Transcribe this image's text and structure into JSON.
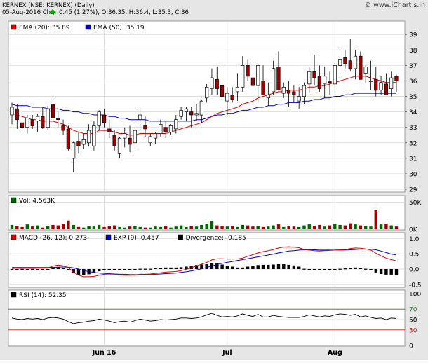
{
  "header": {
    "line1": "KERNEX (NSE: KERNEX) (Daily)",
    "line2_prefix": "05-Aug-2016 Chg:",
    "line2_change": "0.45 (1.27%), O:36.35, H:36.4, L:35.3, C:36",
    "brand": "© www.iChart s.in",
    "arrow_color": "#00aa00"
  },
  "colors": {
    "frame_bg": "#e6e6e6",
    "panel_bg": "#ffffff",
    "grid": "#d8d8d8",
    "up_fill": "#ffffff",
    "down_fill": "#a00000",
    "ema20": "#dd0000",
    "ema50": "#0000cc",
    "vol_up": "#006600",
    "vol_down": "#a00000",
    "macd": "#dd0000",
    "signal": "#0000cc",
    "divergence": "#000000",
    "rsi": "#000000",
    "rsi_70": "#2a7a2a",
    "rsi_30": "#c02020"
  },
  "chart_data": [
    {
      "type": "candlestick",
      "title": "Price",
      "legend": [
        {
          "label": "EMA (20): 35.89",
          "color": "#dd0000"
        },
        {
          "label": "EMA (50): 35.19",
          "color": "#0000cc"
        }
      ],
      "ylim": [
        29,
        39.5
      ],
      "y_ticks": [
        "29",
        "30",
        "31",
        "32",
        "33",
        "34",
        "35",
        "36",
        "37",
        "38",
        "39"
      ],
      "x_labels": [
        {
          "label": "Jun 16",
          "index": 18
        },
        {
          "label": "Jul",
          "index": 42
        },
        {
          "label": "Aug",
          "index": 63
        }
      ],
      "ohlc": [
        [
          33.8,
          34.6,
          33.2,
          34.3
        ],
        [
          34.2,
          34.5,
          32.9,
          33.5
        ],
        [
          33.3,
          33.7,
          32.6,
          33.0
        ],
        [
          33.0,
          33.8,
          32.6,
          33.6
        ],
        [
          33.5,
          33.8,
          32.9,
          33.1
        ],
        [
          33.4,
          33.9,
          32.7,
          33.7
        ],
        [
          33.7,
          34.3,
          32.9,
          33.0
        ],
        [
          33.0,
          34.4,
          32.8,
          34.2
        ],
        [
          34.5,
          34.8,
          33.2,
          33.6
        ],
        [
          33.6,
          34.0,
          33.0,
          33.5
        ],
        [
          33.1,
          33.5,
          32.5,
          32.8
        ],
        [
          32.9,
          33.1,
          31.5,
          31.6
        ],
        [
          31.0,
          32.1,
          30.1,
          32.0
        ],
        [
          32.1,
          32.7,
          31.3,
          31.8
        ],
        [
          31.9,
          32.6,
          31.6,
          32.2
        ],
        [
          32.0,
          33.2,
          31.8,
          32.8
        ],
        [
          31.8,
          33.4,
          31.5,
          33.1
        ],
        [
          33.1,
          34.1,
          32.8,
          34.0
        ],
        [
          33.8,
          34.2,
          33.0,
          33.3
        ],
        [
          32.9,
          33.5,
          32.3,
          32.7
        ],
        [
          32.5,
          32.8,
          31.5,
          31.8
        ],
        [
          31.3,
          32.4,
          31.0,
          32.3
        ],
        [
          32.3,
          33.0,
          31.7,
          32.6
        ],
        [
          32.3,
          33.1,
          31.4,
          31.9
        ],
        [
          32.0,
          33.0,
          31.5,
          32.8
        ],
        [
          33.5,
          34.3,
          32.8,
          33.8
        ],
        [
          33.1,
          33.7,
          32.4,
          32.9
        ],
        [
          32.0,
          32.6,
          31.8,
          32.4
        ],
        [
          32.3,
          32.7,
          31.9,
          32.6
        ],
        [
          32.6,
          33.5,
          32.4,
          33.2
        ],
        [
          33.0,
          33.4,
          32.3,
          32.7
        ],
        [
          32.7,
          33.2,
          32.5,
          33.1
        ],
        [
          32.9,
          33.8,
          32.6,
          33.5
        ],
        [
          33.7,
          34.3,
          33.5,
          34.1
        ],
        [
          34.0,
          34.3,
          33.4,
          34.2
        ],
        [
          34.0,
          34.3,
          33.0,
          33.8
        ],
        [
          33.8,
          34.5,
          33.4,
          33.9
        ],
        [
          33.8,
          34.8,
          33.3,
          34.7
        ],
        [
          34.9,
          35.8,
          34.6,
          35.6
        ],
        [
          35.5,
          36.8,
          35.1,
          36.2
        ],
        [
          36.1,
          36.9,
          35.1,
          35.5
        ],
        [
          35.7,
          37.0,
          35.3,
          35.0
        ],
        [
          34.7,
          35.6,
          33.8,
          35.2
        ],
        [
          35.1,
          35.6,
          34.6,
          34.8
        ],
        [
          35.3,
          36.5,
          34.7,
          35.6
        ],
        [
          35.6,
          37.6,
          35.3,
          37.0
        ],
        [
          37.0,
          37.4,
          36.0,
          36.3
        ],
        [
          36.2,
          36.9,
          35.0,
          35.7
        ],
        [
          35.7,
          37.1,
          34.6,
          37.0
        ],
        [
          36.0,
          37.0,
          35.2,
          35.1
        ],
        [
          34.9,
          35.9,
          34.4,
          35.1
        ],
        [
          35.3,
          37.3,
          35.1,
          36.8
        ],
        [
          36.9,
          37.9,
          35.8,
          35.4
        ],
        [
          35.2,
          35.9,
          34.9,
          35.6
        ],
        [
          35.4,
          36.0,
          34.3,
          35.2
        ],
        [
          35.3,
          35.7,
          34.6,
          35.1
        ],
        [
          34.7,
          35.6,
          34.2,
          35.0
        ],
        [
          35.0,
          35.9,
          34.5,
          35.7
        ],
        [
          35.8,
          36.9,
          35.2,
          36.6
        ],
        [
          36.6,
          37.7,
          35.7,
          36.2
        ],
        [
          36.3,
          37.0,
          35.3,
          35.5
        ],
        [
          35.8,
          36.9,
          34.9,
          36.3
        ],
        [
          36.0,
          36.6,
          35.1,
          35.9
        ],
        [
          35.8,
          37.2,
          35.4,
          37.0
        ],
        [
          37.0,
          38.2,
          36.3,
          37.4
        ],
        [
          37.5,
          38.0,
          36.8,
          37.1
        ],
        [
          37.3,
          38.7,
          36.6,
          36.8
        ],
        [
          36.8,
          38.0,
          36.1,
          37.6
        ],
        [
          37.6,
          37.9,
          36.5,
          36.1
        ],
        [
          36.5,
          37.0,
          35.9,
          36.9
        ],
        [
          36.0,
          37.3,
          35.4,
          36.0
        ],
        [
          36.1,
          36.9,
          35.0,
          35.4
        ],
        [
          35.4,
          36.3,
          35.1,
          35.9
        ],
        [
          35.8,
          36.5,
          35.1,
          35.1
        ],
        [
          35.5,
          36.6,
          35.0,
          36.2
        ],
        [
          36.3,
          36.4,
          35.3,
          36.0
        ]
      ],
      "ema20": [
        33.9,
        33.8,
        33.7,
        33.6,
        33.5,
        33.5,
        33.4,
        33.4,
        33.4,
        33.3,
        33.2,
        33.0,
        32.8,
        32.7,
        32.6,
        32.6,
        32.6,
        32.8,
        32.8,
        32.8,
        32.7,
        32.6,
        32.6,
        32.5,
        32.5,
        32.6,
        32.6,
        32.6,
        32.6,
        32.6,
        32.6,
        32.7,
        32.8,
        32.9,
        33.0,
        33.1,
        33.2,
        33.3,
        33.5,
        33.7,
        33.9,
        34.0,
        34.1,
        34.2,
        34.3,
        34.5,
        34.6,
        34.7,
        34.9,
        35.0,
        35.1,
        35.2,
        35.3,
        35.3,
        35.4,
        35.4,
        35.4,
        35.5,
        35.6,
        35.6,
        35.7,
        35.7,
        35.8,
        35.9,
        36.0,
        36.1,
        36.2,
        36.3,
        36.3,
        36.3,
        36.2,
        36.1,
        36.0,
        35.9,
        35.9,
        35.9
      ],
      "ema50": [
        34.5,
        34.4,
        34.4,
        34.4,
        34.3,
        34.3,
        34.3,
        34.2,
        34.2,
        34.2,
        34.1,
        34.1,
        34.0,
        34.0,
        33.9,
        33.9,
        33.8,
        33.8,
        33.8,
        33.7,
        33.7,
        33.6,
        33.6,
        33.5,
        33.5,
        33.5,
        33.5,
        33.4,
        33.4,
        33.4,
        33.4,
        33.4,
        33.4,
        33.4,
        33.4,
        33.4,
        33.5,
        33.5,
        33.6,
        33.7,
        33.8,
        33.8,
        33.9,
        33.9,
        34.0,
        34.1,
        34.1,
        34.2,
        34.3,
        34.3,
        34.4,
        34.4,
        34.5,
        34.5,
        34.6,
        34.6,
        34.6,
        34.7,
        34.7,
        34.8,
        34.8,
        34.9,
        34.9,
        35.0,
        35.0,
        35.1,
        35.1,
        35.2,
        35.2,
        35.2,
        35.2,
        35.2,
        35.2,
        35.2,
        35.2,
        35.2
      ]
    },
    {
      "type": "bar",
      "title": "Volume",
      "legend": [
        {
          "label": "Vol: 4.563K",
          "color": "#006600"
        }
      ],
      "y_ticks": [
        "50K",
        "0K"
      ],
      "ylim": [
        0,
        60000
      ],
      "volume": [
        8000,
        6000,
        4000,
        9000,
        5000,
        7000,
        3000,
        6000,
        8000,
        7000,
        10000,
        16000,
        8000,
        4000,
        3000,
        6000,
        5000,
        8000,
        4000,
        6000,
        7000,
        4000,
        3000,
        5000,
        6000,
        4000,
        3000,
        3000,
        5000,
        4000,
        6000,
        3000,
        5000,
        7000,
        4000,
        6000,
        5000,
        8000,
        10000,
        15000,
        7000,
        6000,
        5000,
        6000,
        4000,
        8000,
        7000,
        5000,
        6000,
        4000,
        5000,
        7000,
        9000,
        4000,
        6000,
        5000,
        4000,
        7000,
        9000,
        6000,
        8000,
        5000,
        7000,
        10000,
        8000,
        7000,
        11000,
        9000,
        7000,
        6000,
        5000,
        36000,
        9000,
        10000,
        7000,
        5000
      ]
    },
    {
      "type": "line",
      "title": "MACD",
      "legend": [
        {
          "label": "MACD (26, 12): 0.273",
          "color": "#dd0000"
        },
        {
          "label": "EXP (9): 0.457",
          "color": "#0000cc"
        },
        {
          "label": "Divergence: -0.185",
          "color": "#000000"
        }
      ],
      "y_ticks": [
        "1.0",
        "0.5",
        "0.0",
        "-0.5"
      ],
      "ylim": [
        -0.55,
        1.1
      ],
      "macd": [
        0.02,
        0.03,
        0.02,
        0.03,
        0.02,
        0.03,
        0.03,
        0.04,
        0.1,
        0.13,
        0.11,
        0.05,
        -0.1,
        -0.2,
        -0.25,
        -0.25,
        -0.24,
        -0.2,
        -0.17,
        -0.16,
        -0.17,
        -0.18,
        -0.2,
        -0.2,
        -0.19,
        -0.17,
        -0.17,
        -0.16,
        -0.14,
        -0.12,
        -0.1,
        -0.09,
        -0.08,
        -0.05,
        -0.01,
        0.05,
        0.1,
        0.16,
        0.22,
        0.3,
        0.34,
        0.34,
        0.33,
        0.33,
        0.33,
        0.36,
        0.42,
        0.47,
        0.53,
        0.57,
        0.6,
        0.64,
        0.69,
        0.72,
        0.73,
        0.72,
        0.7,
        0.64,
        0.62,
        0.6,
        0.59,
        0.6,
        0.61,
        0.62,
        0.63,
        0.64,
        0.67,
        0.69,
        0.68,
        0.66,
        0.62,
        0.52,
        0.43,
        0.36,
        0.31,
        0.27
      ],
      "signal": [
        0.05,
        0.05,
        0.05,
        0.05,
        0.05,
        0.05,
        0.05,
        0.05,
        0.06,
        0.06,
        0.07,
        0.06,
        0.04,
        0.0,
        -0.05,
        -0.08,
        -0.11,
        -0.13,
        -0.14,
        -0.15,
        -0.16,
        -0.17,
        -0.17,
        -0.18,
        -0.18,
        -0.18,
        -0.18,
        -0.17,
        -0.17,
        -0.16,
        -0.15,
        -0.14,
        -0.13,
        -0.11,
        -0.09,
        -0.06,
        -0.03,
        0.01,
        0.06,
        0.1,
        0.15,
        0.19,
        0.22,
        0.25,
        0.28,
        0.31,
        0.34,
        0.37,
        0.4,
        0.43,
        0.46,
        0.49,
        0.53,
        0.56,
        0.59,
        0.6,
        0.62,
        0.63,
        0.63,
        0.63,
        0.62,
        0.62,
        0.62,
        0.62,
        0.62,
        0.62,
        0.63,
        0.64,
        0.65,
        0.65,
        0.65,
        0.63,
        0.59,
        0.54,
        0.49,
        0.46
      ],
      "divergence": [
        0.0,
        0.0,
        0.0,
        0.0,
        0.0,
        0.0,
        0.0,
        0.0,
        0.04,
        0.07,
        0.04,
        -0.01,
        -0.14,
        -0.2,
        -0.2,
        -0.17,
        -0.13,
        -0.07,
        -0.03,
        -0.01,
        -0.01,
        -0.01,
        -0.03,
        -0.02,
        -0.01,
        0.01,
        0.01,
        0.01,
        0.03,
        0.04,
        0.05,
        0.05,
        0.05,
        0.06,
        0.08,
        0.11,
        0.13,
        0.15,
        0.16,
        0.2,
        0.19,
        0.15,
        0.11,
        0.08,
        0.05,
        0.05,
        0.08,
        0.1,
        0.13,
        0.14,
        0.14,
        0.15,
        0.16,
        0.16,
        0.14,
        0.12,
        0.08,
        0.01,
        -0.01,
        -0.03,
        -0.03,
        -0.02,
        -0.01,
        0.0,
        0.01,
        0.02,
        0.04,
        0.05,
        0.03,
        0.01,
        -0.03,
        -0.11,
        -0.16,
        -0.18,
        -0.18,
        -0.19
      ]
    },
    {
      "type": "line",
      "title": "RSI",
      "legend": [
        {
          "label": "RSI (14): 52.35",
          "color": "#000000"
        }
      ],
      "y_ticks": [
        "100",
        "70",
        "50",
        "30",
        "0"
      ],
      "ylim": [
        0,
        100
      ],
      "reference_lines": [
        70,
        30
      ],
      "rsi": [
        53,
        51,
        50,
        52,
        51,
        52,
        50,
        53,
        54,
        53,
        51,
        46,
        42,
        44,
        45,
        47,
        48,
        51,
        49,
        47,
        44,
        46,
        47,
        45,
        48,
        51,
        49,
        47,
        48,
        50,
        49,
        50,
        51,
        53,
        53,
        52,
        53,
        55,
        59,
        62,
        58,
        55,
        56,
        55,
        57,
        61,
        58,
        56,
        60,
        55,
        55,
        58,
        56,
        55,
        54,
        54,
        54,
        56,
        59,
        57,
        55,
        57,
        56,
        59,
        61,
        60,
        58,
        60,
        55,
        57,
        54,
        52,
        53,
        50,
        53,
        52
      ]
    }
  ]
}
